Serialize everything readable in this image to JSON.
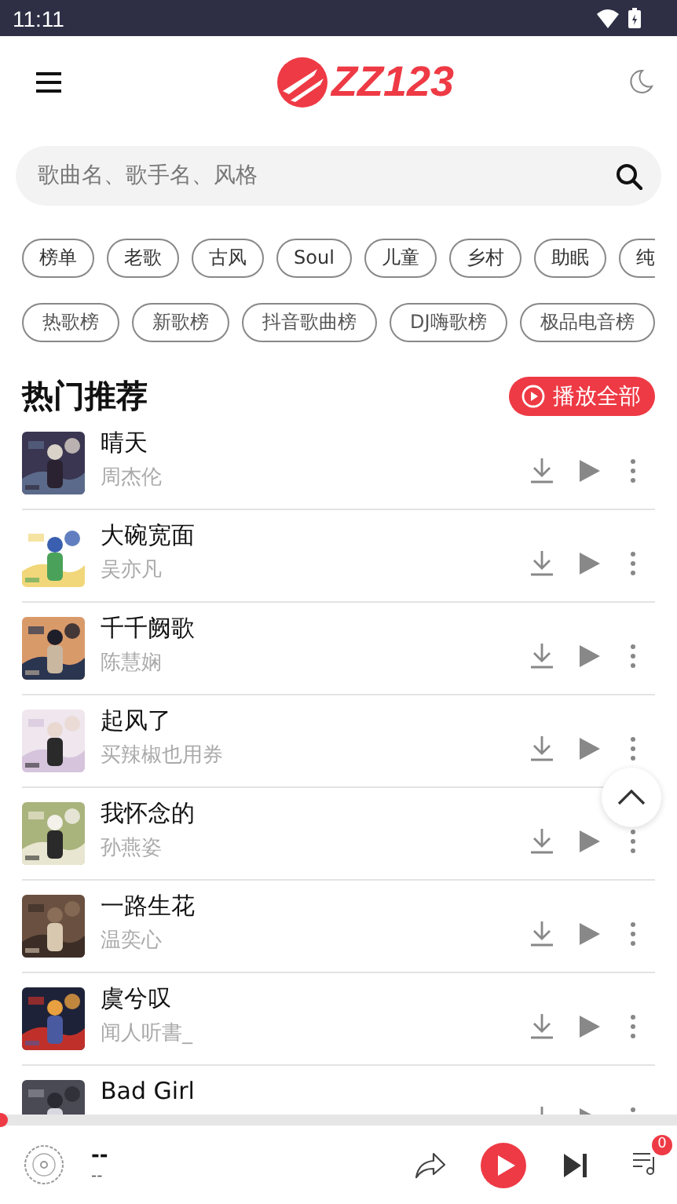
{
  "status_bar": {
    "time": "11:11"
  },
  "header": {
    "logo_text": "ZZ123"
  },
  "search": {
    "placeholder": "歌曲名、歌手名、风格"
  },
  "genre_tags": [
    {
      "label": "榜单"
    },
    {
      "label": "老歌"
    },
    {
      "label": "古风"
    },
    {
      "label": "Soul"
    },
    {
      "label": "儿童"
    },
    {
      "label": "乡村"
    },
    {
      "label": "助眠"
    },
    {
      "label": "纯"
    }
  ],
  "chart_tags": [
    {
      "label": "热歌榜"
    },
    {
      "label": "新歌榜"
    },
    {
      "label": "抖音歌曲榜"
    },
    {
      "label": "DJ嗨歌榜"
    },
    {
      "label": "极品电音榜"
    }
  ],
  "section": {
    "title": "热门推荐",
    "play_all": "播放全部"
  },
  "songs": [
    {
      "title": "晴天",
      "artist": "周杰伦"
    },
    {
      "title": "大碗宽面",
      "artist": "吴亦凡"
    },
    {
      "title": "千千阙歌",
      "artist": "陈慧娴"
    },
    {
      "title": "起风了",
      "artist": "买辣椒也用券"
    },
    {
      "title": "我怀念的",
      "artist": "孙燕姿"
    },
    {
      "title": "一路生花",
      "artist": "温奕心"
    },
    {
      "title": "虞兮叹",
      "artist": "闻人听書_"
    },
    {
      "title": "Bad Girl"
    }
  ],
  "player": {
    "title": "--",
    "artist": "--",
    "level": 0,
    "queue_count": "0"
  }
}
